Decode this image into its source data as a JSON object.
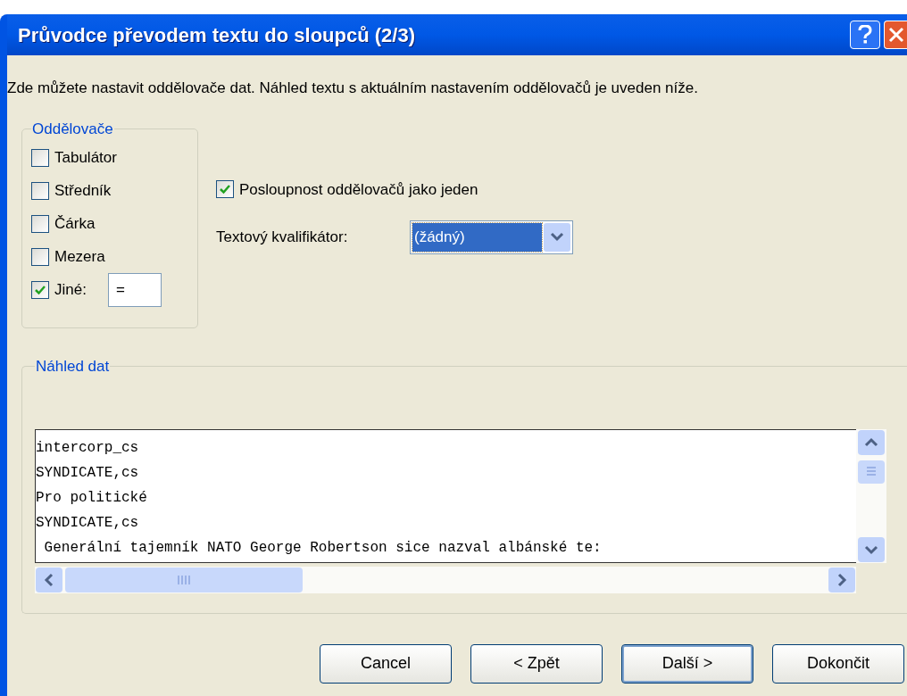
{
  "window": {
    "title": "Průvodce převodem textu do sloupců (2/3)"
  },
  "description": "Zde můžete nastavit oddělovače dat. Náhled textu s aktuálním nastavením oddělovačů je uveden níže.",
  "delimiters": {
    "title": "Oddělovače",
    "items": [
      {
        "label": "Tabulátor",
        "checked": false
      },
      {
        "label": "Středník",
        "checked": false
      },
      {
        "label": "Čárka",
        "checked": false
      },
      {
        "label": "Mezera",
        "checked": false
      },
      {
        "label": "Jiné:",
        "checked": true,
        "value": "="
      }
    ]
  },
  "treat_consecutive": {
    "label": "Posloupnost oddělovačů jako jeden",
    "checked": true
  },
  "text_qualifier": {
    "label": "Textový kvalifikátor:",
    "value": "(žádný)"
  },
  "preview": {
    "title": "Náhled dat",
    "lines": [
      "intercorp_cs",
      "SYNDICATE,cs",
      "Pro politické",
      "SYNDICATE,cs",
      " Generální tajemník NATO George Robertson sice nazval albánské te:"
    ]
  },
  "buttons": [
    {
      "label": "Cancel",
      "default": false
    },
    {
      "label": "< Zpět",
      "default": false
    },
    {
      "label": "Další >",
      "default": true
    },
    {
      "label": "Dokončit",
      "default": false
    }
  ]
}
